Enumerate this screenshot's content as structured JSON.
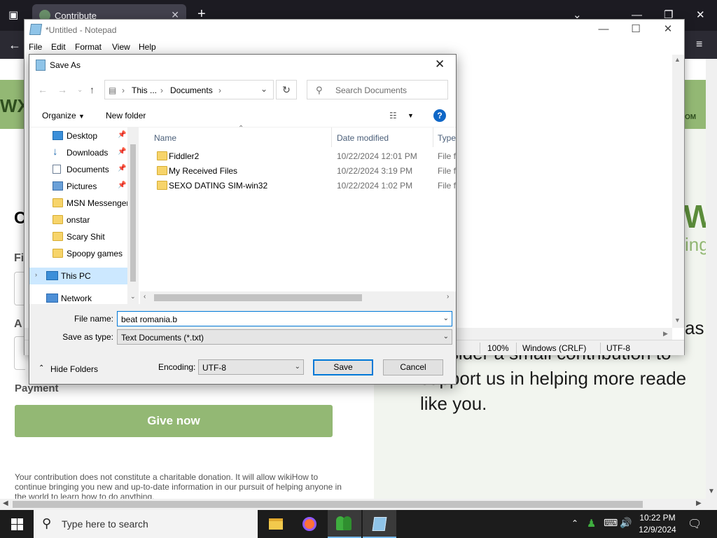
{
  "browser": {
    "tab_title": "Contribute",
    "page": {
      "big_text_1": "as",
      "big_text_2": "consider a small contribution to",
      "big_text_3": "support us in helping more reade",
      "big_text_4": "like you.",
      "heading_partial": "C",
      "field_label_1": "Fi",
      "field_label_2": "A",
      "payment_label": "Payment",
      "give_now": "Give now",
      "disclaimer": "Your contribution does not constitute a charitable donation. It will allow wikiHow to continue bringing you new and up-to-date information in our pursuit of helping anyone in the world to learn how to do anything."
    }
  },
  "notepad": {
    "title": "*Untitled - Notepad",
    "menu": [
      "File",
      "Edit",
      "Format",
      "View",
      "Help"
    ],
    "status": {
      "zoom": "100%",
      "line_ending": "Windows (CRLF)",
      "encoding": "UTF-8"
    }
  },
  "dialog": {
    "title": "Save As",
    "address": {
      "seg1": "This ...",
      "seg2": "Documents"
    },
    "search_placeholder": "Search Documents",
    "organize": "Organize",
    "new_folder": "New folder",
    "help": "?",
    "nav_items": [
      {
        "label": "Desktop",
        "icon": "desktop-icon",
        "pinned": true
      },
      {
        "label": "Downloads",
        "icon": "download-arrow-icon",
        "pinned": true
      },
      {
        "label": "Documents",
        "icon": "document-icon",
        "pinned": true
      },
      {
        "label": "Pictures",
        "icon": "pictures-icon",
        "pinned": true
      },
      {
        "label": "MSN Messenger",
        "icon": "folder-icon",
        "pinned": false
      },
      {
        "label": "onstar",
        "icon": "folder-icon",
        "pinned": false
      },
      {
        "label": "Scary Shit",
        "icon": "folder-icon",
        "pinned": false
      },
      {
        "label": "Spoopy games",
        "icon": "folder-icon",
        "pinned": false
      }
    ],
    "this_pc": "This PC",
    "network": "Network",
    "columns": {
      "name": "Name",
      "date": "Date modified",
      "type": "Type"
    },
    "files": [
      {
        "name": "Fiddler2",
        "date": "10/22/2024 12:01 PM",
        "type": "File folder"
      },
      {
        "name": "My Received Files",
        "date": "10/22/2024 3:19 PM",
        "type": "File folder"
      },
      {
        "name": "SEXO DATING SIM-win32",
        "date": "10/22/2024 1:02 PM",
        "type": "File folder"
      }
    ],
    "file_name_label": "File name:",
    "file_name_value": "beat romania.b",
    "save_type_label": "Save as type:",
    "save_type_value": "Text Documents (*.txt)",
    "hide_folders": "Hide Folders",
    "encoding_label": "Encoding:",
    "encoding_value": "UTF-8",
    "save": "Save",
    "cancel": "Cancel"
  },
  "taskbar": {
    "search_placeholder": "Type here to search",
    "time": "10:22 PM",
    "date": "12/9/2024"
  },
  "colors": {
    "wikihow_green": "#93b874",
    "accent_blue": "#0078d7",
    "selection": "#cce8ff"
  }
}
